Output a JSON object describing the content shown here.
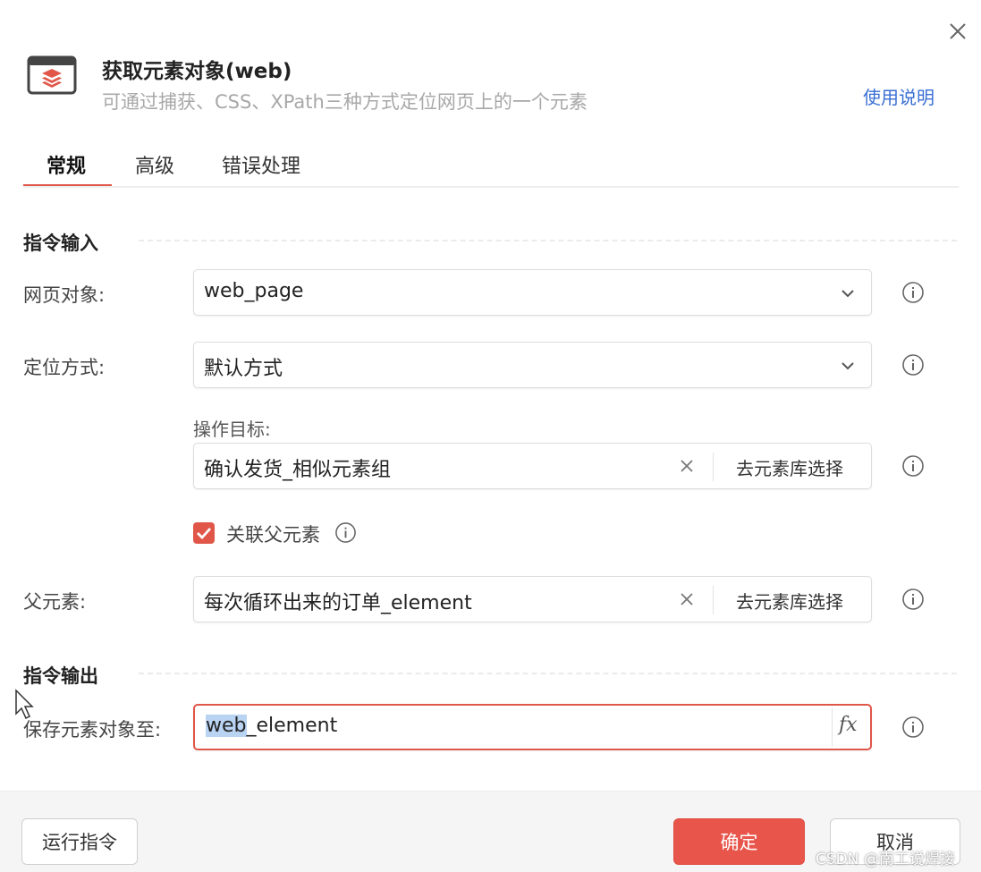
{
  "header": {
    "title": "获取元素对象(web)",
    "subtitle": "可通过捕获、CSS、XPath三种方式定位网页上的一个元素",
    "help_link": "使用说明",
    "icon": "browser-layers-icon",
    "close_icon": "close-icon"
  },
  "tabs": [
    {
      "label": "常规",
      "active": true
    },
    {
      "label": "高级",
      "active": false
    },
    {
      "label": "错误处理",
      "active": false
    }
  ],
  "input_section": {
    "title": "指令输入",
    "web_page": {
      "label": "网页对象:",
      "value": "web_page"
    },
    "locate_method": {
      "label": "定位方式:",
      "value": "默认方式"
    },
    "target": {
      "label": "操作目标:",
      "value": "确认发货_相似元素组",
      "button": "去元素库选择"
    },
    "associate_parent": {
      "label": "关联父元素",
      "checked": true
    },
    "parent_element": {
      "label": "父元素:",
      "value": "每次循环出来的订单_element",
      "button": "去元素库选择"
    }
  },
  "output_section": {
    "title": "指令输出",
    "save_to": {
      "label": "保存元素对象至:",
      "value_selected": "web",
      "value_rest": "_element",
      "fx": "fx"
    }
  },
  "footer": {
    "run_button": "运行指令",
    "ok_button": "确定",
    "cancel_button": "取消"
  },
  "watermark": "CSDN @南工说焊接",
  "colors": {
    "accent": "#e0574a",
    "link": "#3a6fd4",
    "selection": "#b9d3f3"
  }
}
